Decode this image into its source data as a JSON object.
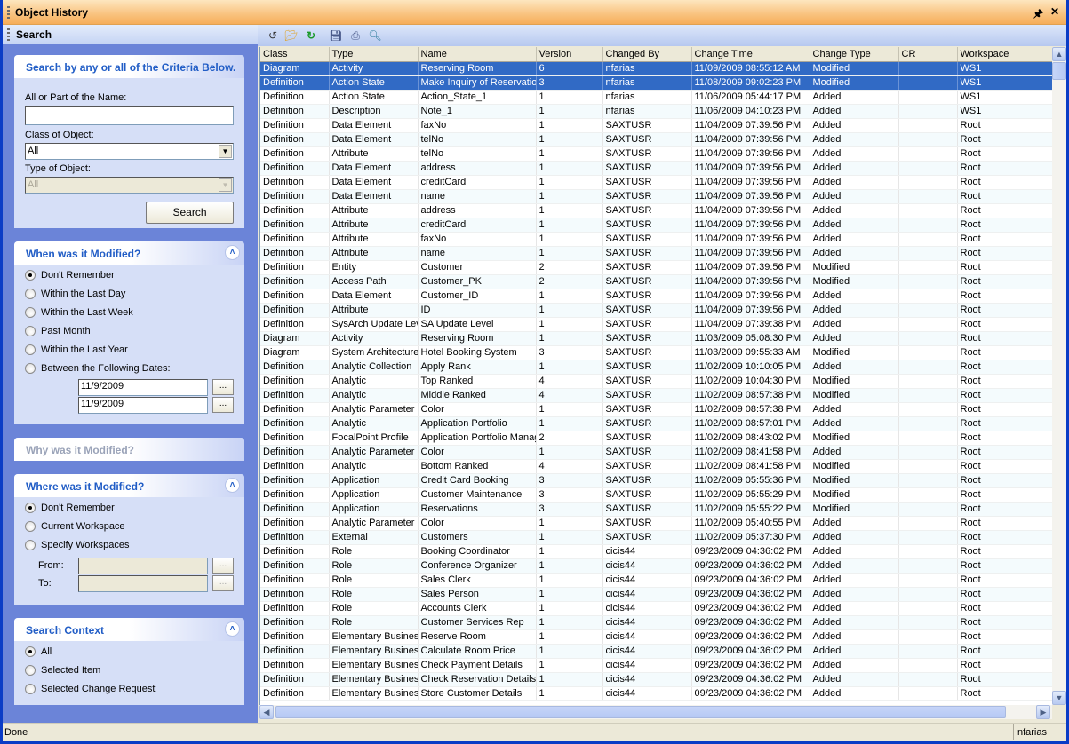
{
  "window": {
    "title": "Object History",
    "pin_icon": "pin-icon",
    "close_icon": "close-icon"
  },
  "search_pane": {
    "title": "Search",
    "criteria": {
      "heading": "Search by any or all of the Criteria Below.",
      "name_label": "All or Part of the Name:",
      "name_value": "",
      "class_label": "Class of Object:",
      "class_value": "All",
      "type_label": "Type of Object:",
      "type_value": "All",
      "search_button": "Search"
    },
    "when": {
      "heading": "When was it Modified?",
      "options": [
        "Don't Remember",
        "Within the Last Day",
        "Within the Last Week",
        "Past Month",
        "Within the Last Year",
        "Between the Following Dates:"
      ],
      "selected": 0,
      "date_from": "11/9/2009",
      "date_to": "11/9/2009",
      "browse": "..."
    },
    "why": {
      "heading": "Why was it Modified?"
    },
    "where": {
      "heading": "Where was it Modified?",
      "options": [
        "Don't Remember",
        "Current Workspace",
        "Specify Workspaces"
      ],
      "selected": 0,
      "from_label": "From:",
      "to_label": "To:",
      "browse": "..."
    },
    "context": {
      "heading": "Search Context",
      "options": [
        "All",
        "Selected Item",
        "Selected Change Request"
      ],
      "selected": 0
    }
  },
  "toolbar": {
    "icons": [
      "history-icon",
      "open-folder-icon",
      "refresh-icon",
      "save-icon",
      "print-icon",
      "find-icon"
    ]
  },
  "grid": {
    "columns": [
      "Class",
      "Type",
      "Name",
      "Version",
      "Changed By",
      "Change Time",
      "Change Type",
      "CR",
      "Workspace"
    ],
    "rows": [
      [
        "Diagram",
        "Activity",
        "Reserving Room",
        "6",
        "nfarias",
        "11/09/2009 08:55:12 AM",
        "Modified",
        "",
        "WS1"
      ],
      [
        "Definition",
        "Action State",
        "Make Inquiry of Reservatio",
        "3",
        "nfarias",
        "11/08/2009 09:02:23 PM",
        "Modified",
        "",
        "WS1"
      ],
      [
        "Definition",
        "Action State",
        "Action_State_1",
        "1",
        "nfarias",
        "11/06/2009 05:44:17 PM",
        "Added",
        "",
        "WS1"
      ],
      [
        "Definition",
        "Description",
        "Note_1",
        "1",
        "nfarias",
        "11/06/2009 04:10:23 PM",
        "Added",
        "",
        "WS1"
      ],
      [
        "Definition",
        "Data Element",
        "faxNo",
        "1",
        "SAXTUSR",
        "11/04/2009 07:39:56 PM",
        "Added",
        "",
        "Root"
      ],
      [
        "Definition",
        "Data Element",
        "telNo",
        "1",
        "SAXTUSR",
        "11/04/2009 07:39:56 PM",
        "Added",
        "",
        "Root"
      ],
      [
        "Definition",
        "Attribute",
        "telNo",
        "1",
        "SAXTUSR",
        "11/04/2009 07:39:56 PM",
        "Added",
        "",
        "Root"
      ],
      [
        "Definition",
        "Data Element",
        "address",
        "1",
        "SAXTUSR",
        "11/04/2009 07:39:56 PM",
        "Added",
        "",
        "Root"
      ],
      [
        "Definition",
        "Data Element",
        "creditCard",
        "1",
        "SAXTUSR",
        "11/04/2009 07:39:56 PM",
        "Added",
        "",
        "Root"
      ],
      [
        "Definition",
        "Data Element",
        "name",
        "1",
        "SAXTUSR",
        "11/04/2009 07:39:56 PM",
        "Added",
        "",
        "Root"
      ],
      [
        "Definition",
        "Attribute",
        "address",
        "1",
        "SAXTUSR",
        "11/04/2009 07:39:56 PM",
        "Added",
        "",
        "Root"
      ],
      [
        "Definition",
        "Attribute",
        "creditCard",
        "1",
        "SAXTUSR",
        "11/04/2009 07:39:56 PM",
        "Added",
        "",
        "Root"
      ],
      [
        "Definition",
        "Attribute",
        "faxNo",
        "1",
        "SAXTUSR",
        "11/04/2009 07:39:56 PM",
        "Added",
        "",
        "Root"
      ],
      [
        "Definition",
        "Attribute",
        "name",
        "1",
        "SAXTUSR",
        "11/04/2009 07:39:56 PM",
        "Added",
        "",
        "Root"
      ],
      [
        "Definition",
        "Entity",
        "Customer",
        "2",
        "SAXTUSR",
        "11/04/2009 07:39:56 PM",
        "Modified",
        "",
        "Root"
      ],
      [
        "Definition",
        "Access Path",
        "Customer_PK",
        "2",
        "SAXTUSR",
        "11/04/2009 07:39:56 PM",
        "Modified",
        "",
        "Root"
      ],
      [
        "Definition",
        "Data Element",
        "Customer_ID",
        "1",
        "SAXTUSR",
        "11/04/2009 07:39:56 PM",
        "Added",
        "",
        "Root"
      ],
      [
        "Definition",
        "Attribute",
        "ID",
        "1",
        "SAXTUSR",
        "11/04/2009 07:39:56 PM",
        "Added",
        "",
        "Root"
      ],
      [
        "Definition",
        "SysArch Update Lev",
        "SA Update Level",
        "1",
        "SAXTUSR",
        "11/04/2009 07:39:38 PM",
        "Added",
        "",
        "Root"
      ],
      [
        "Diagram",
        "Activity",
        "Reserving Room",
        "1",
        "SAXTUSR",
        "11/03/2009 05:08:30 PM",
        "Added",
        "",
        "Root"
      ],
      [
        "Diagram",
        "System Architecture",
        "Hotel Booking System",
        "3",
        "SAXTUSR",
        "11/03/2009 09:55:33 AM",
        "Modified",
        "",
        "Root"
      ],
      [
        "Definition",
        "Analytic Collection",
        "Apply Rank",
        "1",
        "SAXTUSR",
        "11/02/2009 10:10:05 PM",
        "Added",
        "",
        "Root"
      ],
      [
        "Definition",
        "Analytic",
        "Top Ranked",
        "4",
        "SAXTUSR",
        "11/02/2009 10:04:30 PM",
        "Modified",
        "",
        "Root"
      ],
      [
        "Definition",
        "Analytic",
        "Middle Ranked",
        "4",
        "SAXTUSR",
        "11/02/2009 08:57:38 PM",
        "Modified",
        "",
        "Root"
      ],
      [
        "Definition",
        "Analytic Parameter",
        "Color",
        "1",
        "SAXTUSR",
        "11/02/2009 08:57:38 PM",
        "Added",
        "",
        "Root"
      ],
      [
        "Definition",
        "Analytic",
        "Application Portfolio",
        "1",
        "SAXTUSR",
        "11/02/2009 08:57:01 PM",
        "Added",
        "",
        "Root"
      ],
      [
        "Definition",
        "FocalPoint Profile",
        "Application Portfolio Manag",
        "2",
        "SAXTUSR",
        "11/02/2009 08:43:02 PM",
        "Modified",
        "",
        "Root"
      ],
      [
        "Definition",
        "Analytic Parameter",
        "Color",
        "1",
        "SAXTUSR",
        "11/02/2009 08:41:58 PM",
        "Added",
        "",
        "Root"
      ],
      [
        "Definition",
        "Analytic",
        "Bottom Ranked",
        "4",
        "SAXTUSR",
        "11/02/2009 08:41:58 PM",
        "Modified",
        "",
        "Root"
      ],
      [
        "Definition",
        "Application",
        "Credit Card Booking",
        "3",
        "SAXTUSR",
        "11/02/2009 05:55:36 PM",
        "Modified",
        "",
        "Root"
      ],
      [
        "Definition",
        "Application",
        "Customer Maintenance",
        "3",
        "SAXTUSR",
        "11/02/2009 05:55:29 PM",
        "Modified",
        "",
        "Root"
      ],
      [
        "Definition",
        "Application",
        "Reservations",
        "3",
        "SAXTUSR",
        "11/02/2009 05:55:22 PM",
        "Modified",
        "",
        "Root"
      ],
      [
        "Definition",
        "Analytic Parameter",
        "Color",
        "1",
        "SAXTUSR",
        "11/02/2009 05:40:55 PM",
        "Added",
        "",
        "Root"
      ],
      [
        "Definition",
        "External",
        "Customers",
        "1",
        "SAXTUSR",
        "11/02/2009 05:37:30 PM",
        "Added",
        "",
        "Root"
      ],
      [
        "Definition",
        "Role",
        "Booking Coordinator",
        "1",
        "cicis44",
        "09/23/2009 04:36:02 PM",
        "Added",
        "",
        "Root"
      ],
      [
        "Definition",
        "Role",
        "Conference Organizer",
        "1",
        "cicis44",
        "09/23/2009 04:36:02 PM",
        "Added",
        "",
        "Root"
      ],
      [
        "Definition",
        "Role",
        "Sales Clerk",
        "1",
        "cicis44",
        "09/23/2009 04:36:02 PM",
        "Added",
        "",
        "Root"
      ],
      [
        "Definition",
        "Role",
        "Sales Person",
        "1",
        "cicis44",
        "09/23/2009 04:36:02 PM",
        "Added",
        "",
        "Root"
      ],
      [
        "Definition",
        "Role",
        "Accounts Clerk",
        "1",
        "cicis44",
        "09/23/2009 04:36:02 PM",
        "Added",
        "",
        "Root"
      ],
      [
        "Definition",
        "Role",
        "Customer Services Rep",
        "1",
        "cicis44",
        "09/23/2009 04:36:02 PM",
        "Added",
        "",
        "Root"
      ],
      [
        "Definition",
        "Elementary Busines:",
        "Reserve Room",
        "1",
        "cicis44",
        "09/23/2009 04:36:02 PM",
        "Added",
        "",
        "Root"
      ],
      [
        "Definition",
        "Elementary Busines:",
        "Calculate Room Price",
        "1",
        "cicis44",
        "09/23/2009 04:36:02 PM",
        "Added",
        "",
        "Root"
      ],
      [
        "Definition",
        "Elementary Busines:",
        "Check Payment Details",
        "1",
        "cicis44",
        "09/23/2009 04:36:02 PM",
        "Added",
        "",
        "Root"
      ],
      [
        "Definition",
        "Elementary Busines:",
        "Check Reservation Details",
        "1",
        "cicis44",
        "09/23/2009 04:36:02 PM",
        "Added",
        "",
        "Root"
      ],
      [
        "Definition",
        "Elementary Busines:",
        "Store Customer Details",
        "1",
        "cicis44",
        "09/23/2009 04:36:02 PM",
        "Added",
        "",
        "Root"
      ]
    ],
    "selected_rows": [
      0,
      1
    ]
  },
  "status": {
    "text": "Done",
    "user": "nfarias"
  }
}
